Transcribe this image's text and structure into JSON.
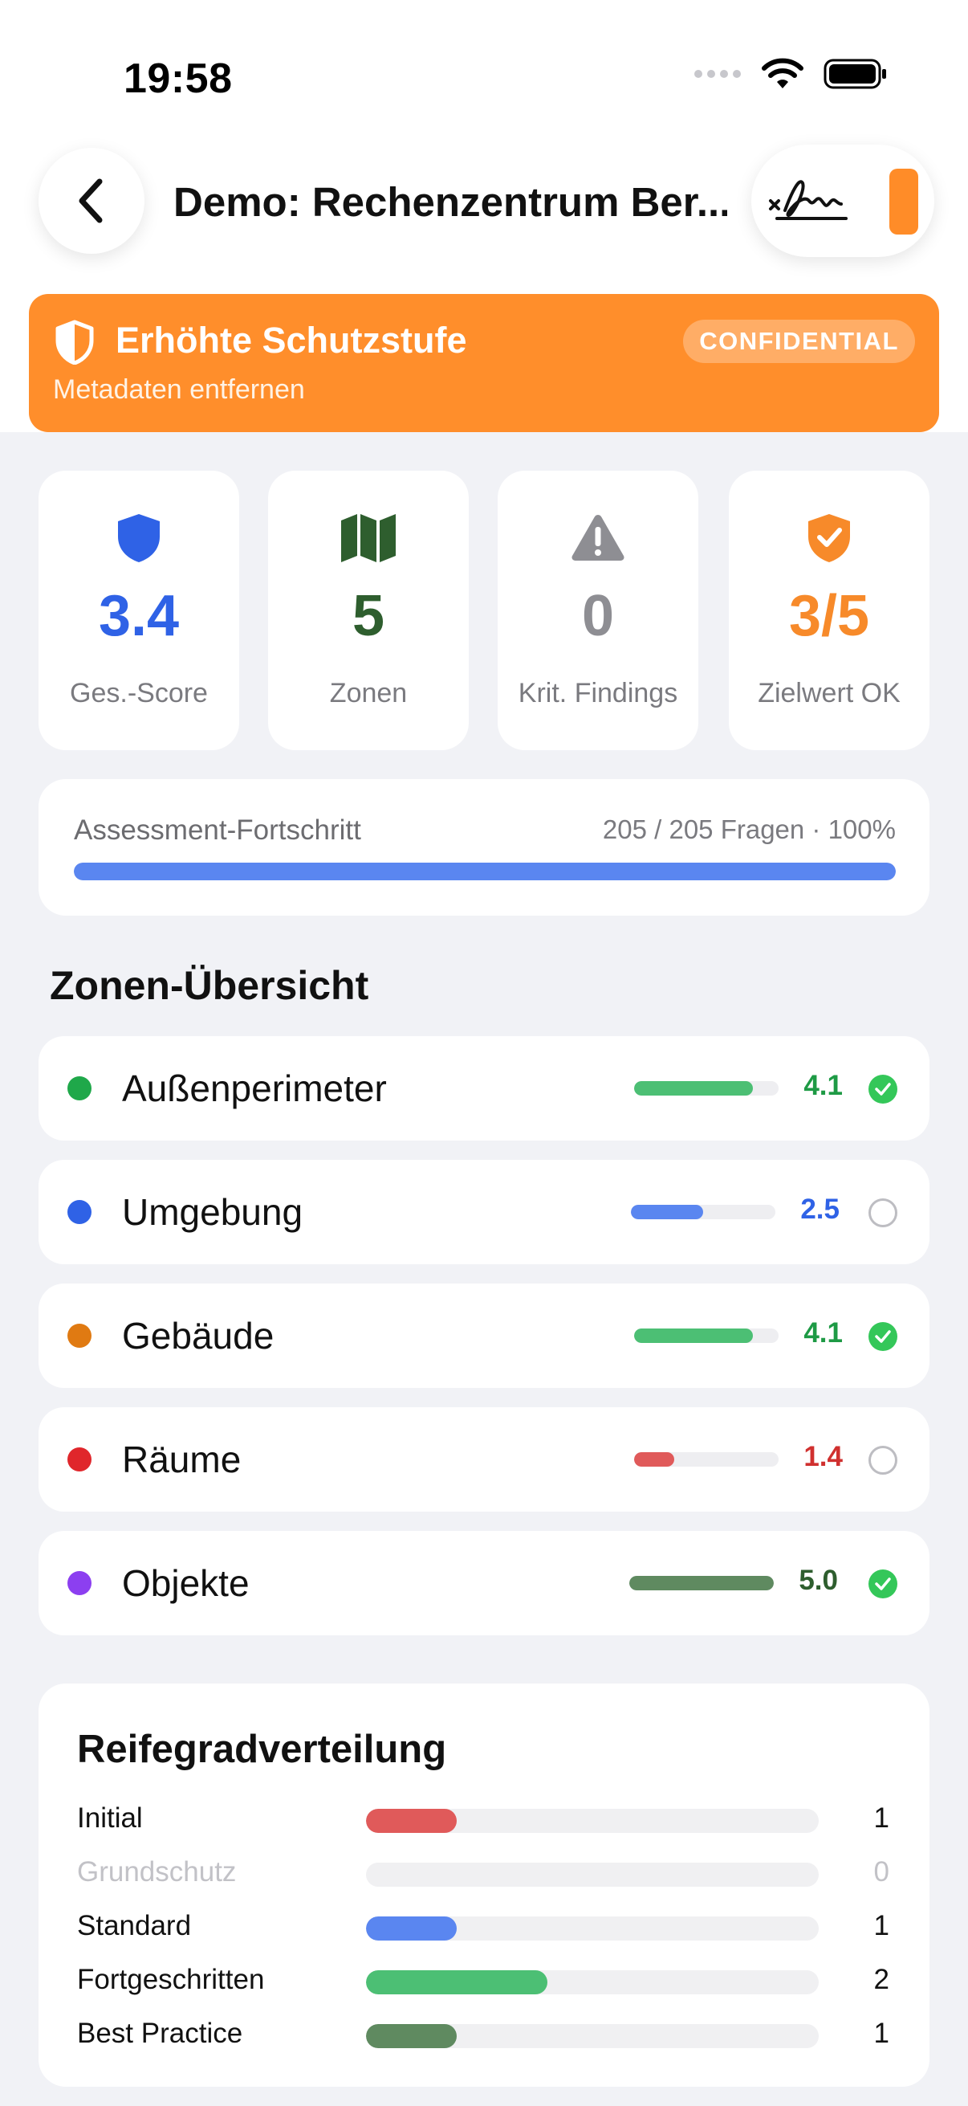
{
  "status_bar": {
    "time": "19:58"
  },
  "nav": {
    "title": "Demo: Rechenzentrum Ber...",
    "back_icon": "chevron-left-icon",
    "sign_icon": "signature-icon"
  },
  "banner": {
    "title": "Erhöhte Schutzstufe",
    "subtitle": "Metadaten entfernen",
    "badge": "CONFIDENTIAL",
    "color": "#FF8E2B"
  },
  "stats": [
    {
      "value": "3.4",
      "label": "Ges.-Score",
      "icon": "shield-icon",
      "color": "#2F62E6"
    },
    {
      "value": "5",
      "label": "Zonen",
      "icon": "map-icon",
      "color": "#2E5E2E"
    },
    {
      "value": "0",
      "label": "Krit. Findings",
      "icon": "warning-icon",
      "color": "#8E8E93"
    },
    {
      "value": "3/5",
      "label": "Zielwert OK",
      "icon": "shield-check-icon",
      "color": "#F78A2A"
    }
  ],
  "progress": {
    "label": "Assessment-Fortschritt",
    "meta": "205 / 205 Fragen · 100%",
    "fraction": 1.0,
    "color": "#5A86F0"
  },
  "zones": {
    "title": "Zonen-Übersicht",
    "items": [
      {
        "name": "Außenperimeter",
        "score": "4.1",
        "fraction": 0.82,
        "dot": "#1FA84A",
        "bar": "#4CBF74",
        "score_color": "#1E9A45",
        "done": true
      },
      {
        "name": "Umgebung",
        "score": "2.5",
        "fraction": 0.5,
        "dot": "#2F62E6",
        "bar": "#5A86F0",
        "score_color": "#2F62E6",
        "done": false
      },
      {
        "name": "Gebäude",
        "score": "4.1",
        "fraction": 0.82,
        "dot": "#E07A12",
        "bar": "#4CBF74",
        "score_color": "#1E9A45",
        "done": true
      },
      {
        "name": "Räume",
        "score": "1.4",
        "fraction": 0.28,
        "dot": "#E0262B",
        "bar": "#E05A5A",
        "score_color": "#D0302F",
        "done": false
      },
      {
        "name": "Objekte",
        "score": "5.0",
        "fraction": 1.0,
        "dot": "#8C3FF0",
        "bar": "#5F8A60",
        "score_color": "#2E5E2E",
        "done": true
      }
    ]
  },
  "maturity": {
    "title": "Reifegradverteilung",
    "max": 5,
    "rows": [
      {
        "label": "Initial",
        "count": "1",
        "value": 1,
        "color": "#E05A5A"
      },
      {
        "label": "Grundschutz",
        "count": "0",
        "value": 0,
        "color": "#E0E0E4"
      },
      {
        "label": "Standard",
        "count": "1",
        "value": 1,
        "color": "#5A86F0"
      },
      {
        "label": "Fortgeschritten",
        "count": "2",
        "value": 2,
        "color": "#4CBF74"
      },
      {
        "label": "Best Practice",
        "count": "1",
        "value": 1,
        "color": "#5F8A60"
      }
    ]
  }
}
